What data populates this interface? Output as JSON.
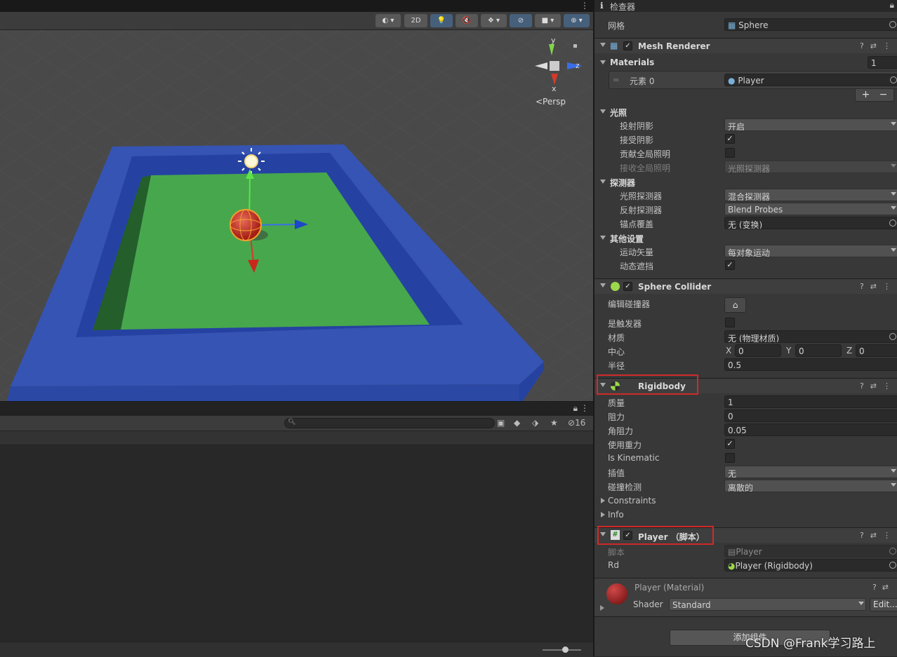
{
  "scene": {
    "toolbar": {
      "btn_2d": "2D",
      "persp_label": "<Persp",
      "gizmo_y": "y",
      "gizmo_z": "z",
      "gizmo_x": "x"
    }
  },
  "bottom": {
    "hidden_count": "16"
  },
  "inspector": {
    "tab_label": "检查器",
    "mesh_label": "网格",
    "mesh_value": "Sphere",
    "mesh_renderer": {
      "title": "Mesh Renderer",
      "materials_label": "Materials",
      "materials_count": "1",
      "element_label": "元素 0",
      "element_value": "Player",
      "add_label": "+",
      "remove_label": "−",
      "lighting": {
        "title": "光照",
        "cast_shadows_label": "投射阴影",
        "cast_shadows_value": "开启",
        "receive_shadows_label": "接受阴影",
        "contribute_gi_label": "贡献全局照明",
        "receive_gi_label": "接收全局照明",
        "receive_gi_value": "光照探测器"
      },
      "probes": {
        "title": "探测器",
        "light_probes_label": "光照探测器",
        "light_probes_value": "混合探测器",
        "reflection_probes_label": "反射探测器",
        "reflection_probes_value": "Blend Probes",
        "anchor_label": "锚点覆盖",
        "anchor_value": "无 (变换)"
      },
      "other": {
        "title": "其他设置",
        "motion_vectors_label": "运动矢量",
        "motion_vectors_value": "每对象运动",
        "dynamic_occlusion_label": "动态遮挡"
      }
    },
    "sphere_collider": {
      "title": "Sphere Collider",
      "edit_label": "编辑碰撞器",
      "is_trigger_label": "是触发器",
      "material_label": "材质",
      "material_value": "无 (物理材质)",
      "center_label": "中心",
      "cx_label": "X",
      "cx": "0",
      "cy_label": "Y",
      "cy": "0",
      "cz_label": "Z",
      "cz": "0",
      "radius_label": "半径",
      "radius": "0.5"
    },
    "rigidbody": {
      "title": "Rigidbody",
      "mass_label": "质量",
      "mass": "1",
      "drag_label": "阻力",
      "drag": "0",
      "angular_drag_label": "角阻力",
      "angular_drag": "0.05",
      "use_gravity_label": "使用重力",
      "is_kinematic_label": "Is Kinematic",
      "interpolate_label": "插值",
      "interpolate": "无",
      "collision_label": "碰撞检测",
      "collision": "离散的",
      "constraints_label": "Constraints",
      "info_label": "Info"
    },
    "player_script": {
      "title": "Player （脚本）",
      "script_label": "脚本",
      "script_value": "Player",
      "rd_label": "Rd",
      "rd_value": "Player (Rigidbody)"
    },
    "material": {
      "title": "Player (Material)",
      "shader_label": "Shader",
      "shader_value": "Standard",
      "edit_label": "Edit..."
    },
    "add_component": "添加组件",
    "watermark": "CSDN @Frank学习路上"
  },
  "colors": {
    "floor": "#4caf50",
    "walls": "#2f4fb0",
    "highlight_box": "#d02a2a"
  }
}
